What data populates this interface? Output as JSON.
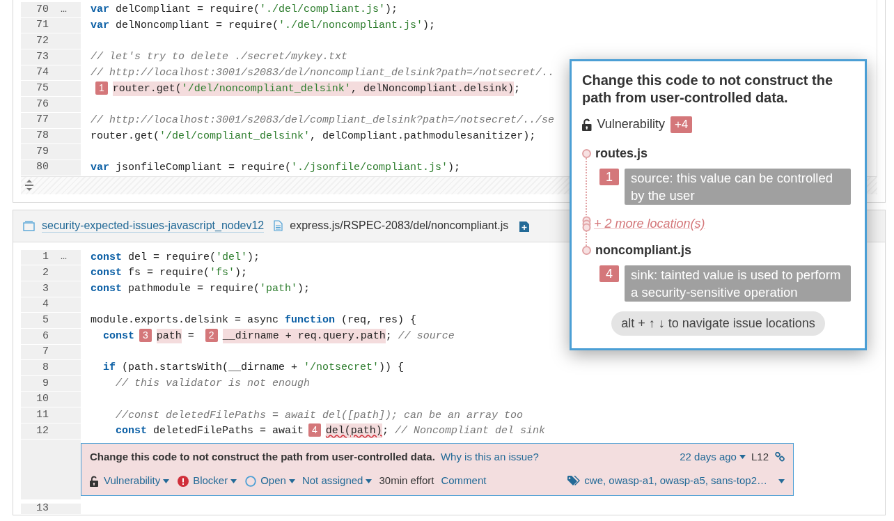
{
  "top_panel": {
    "lines": [
      {
        "number": "70",
        "gutter_mark": "…",
        "segments": [
          {
            "kind": "kw",
            "t": "var"
          },
          {
            "kind": "plain",
            "t": " delCompliant = require("
          },
          {
            "kind": "str",
            "t": "'./del/compliant.js'"
          },
          {
            "kind": "plain",
            "t": ");"
          }
        ]
      },
      {
        "number": "71",
        "segments": [
          {
            "kind": "kw",
            "t": "var"
          },
          {
            "kind": "plain",
            "t": " delNoncompliant = require("
          },
          {
            "kind": "str",
            "t": "'./del/noncompliant.js'"
          },
          {
            "kind": "plain",
            "t": ");"
          }
        ]
      },
      {
        "number": "72"
      },
      {
        "number": "73",
        "segments": [
          {
            "kind": "cmt",
            "t": "// let's try to delete ./secret/mykey.txt"
          }
        ]
      },
      {
        "number": "74",
        "segments": [
          {
            "kind": "cmt",
            "t": "// http://localhost:3001/s2083/del/noncompliant_delsink?path=/notsecret/.."
          }
        ]
      },
      {
        "number": "75",
        "segments": [
          {
            "kind": "marker",
            "t": "1"
          },
          {
            "kind": "plain",
            "t": "router.get(",
            "hl": true
          },
          {
            "kind": "str",
            "t": "'/del/noncompliant_delsink'",
            "hl": true
          },
          {
            "kind": "plain",
            "t": ", delNoncompliant.delsink)",
            "hl": true
          },
          {
            "kind": "plain",
            "t": ";"
          }
        ]
      },
      {
        "number": "76"
      },
      {
        "number": "77",
        "segments": [
          {
            "kind": "cmt",
            "t": "// http://localhost:3001/s2083/del/compliant_delsink?path=/notsecret/../se"
          }
        ]
      },
      {
        "number": "78",
        "segments": [
          {
            "kind": "plain",
            "t": "router.get("
          },
          {
            "kind": "str",
            "t": "'/del/compliant_delsink'"
          },
          {
            "kind": "plain",
            "t": ", delCompliant.pathmodulesanitizer);"
          }
        ]
      },
      {
        "number": "79"
      },
      {
        "number": "80",
        "segments": [
          {
            "kind": "kw",
            "t": "var"
          },
          {
            "kind": "plain",
            "t": " jsonfileCompliant = require("
          },
          {
            "kind": "str",
            "t": "'./jsonfile/compliant.js'"
          },
          {
            "kind": "plain",
            "t": ");"
          }
        ]
      }
    ]
  },
  "file_header": {
    "project": "security-expected-issues-javascript_nodev12",
    "path": "express.js/RSPEC-2083/del/noncompliant.js"
  },
  "bottom_panel": {
    "lines": [
      {
        "number": "1",
        "gutter_mark": "…",
        "segments": [
          {
            "kind": "kw",
            "t": "const"
          },
          {
            "kind": "plain",
            "t": " del = require("
          },
          {
            "kind": "str",
            "t": "'del'"
          },
          {
            "kind": "plain",
            "t": ");"
          }
        ]
      },
      {
        "number": "2",
        "segments": [
          {
            "kind": "kw",
            "t": "const"
          },
          {
            "kind": "plain",
            "t": " fs = require("
          },
          {
            "kind": "str",
            "t": "'fs'"
          },
          {
            "kind": "plain",
            "t": ");"
          }
        ]
      },
      {
        "number": "3",
        "segments": [
          {
            "kind": "kw",
            "t": "const"
          },
          {
            "kind": "plain",
            "t": " pathmodule = require("
          },
          {
            "kind": "str",
            "t": "'path'"
          },
          {
            "kind": "plain",
            "t": ");"
          }
        ]
      },
      {
        "number": "4"
      },
      {
        "number": "5",
        "segments": [
          {
            "kind": "plain",
            "t": "module.exports.delsink = async "
          },
          {
            "kind": "kw",
            "t": "function"
          },
          {
            "kind": "plain",
            "t": " (req, res) {"
          }
        ]
      },
      {
        "number": "6",
        "segments": [
          {
            "kind": "kw",
            "t": "  const"
          },
          {
            "kind": "marker",
            "t": "3"
          },
          {
            "kind": "plain",
            "t": "path",
            "hl": true
          },
          {
            "kind": "plain",
            "t": " = "
          },
          {
            "kind": "marker",
            "t": "2"
          },
          {
            "kind": "plain",
            "t": "__dirname + req.query.path",
            "hl": true
          },
          {
            "kind": "plain",
            "t": ";"
          },
          {
            "kind": "cmt",
            "t": " // source"
          }
        ]
      },
      {
        "number": "7"
      },
      {
        "number": "8",
        "segments": [
          {
            "kind": "kw",
            "t": "  if"
          },
          {
            "kind": "plain",
            "t": " (path.startsWith(__dirname + "
          },
          {
            "kind": "str",
            "t": "'/notsecret'"
          },
          {
            "kind": "plain",
            "t": ")) {"
          }
        ]
      },
      {
        "number": "9",
        "segments": [
          {
            "kind": "cmt",
            "t": "    // this validator is not enough"
          }
        ]
      },
      {
        "number": "10"
      },
      {
        "number": "11",
        "segments": [
          {
            "kind": "cmt",
            "t": "    //const deletedFilePaths = await del([path]); can be an array too"
          }
        ]
      },
      {
        "number": "12",
        "segments": [
          {
            "kind": "kw",
            "t": "    const"
          },
          {
            "kind": "plain",
            "t": " deletedFilePaths = await"
          },
          {
            "kind": "marker",
            "t": "4"
          },
          {
            "kind": "plain",
            "t": "del(path)",
            "hl": true,
            "squiggle": true
          },
          {
            "kind": "plain",
            "t": ";"
          },
          {
            "kind": "cmt",
            "t": " // Noncompliant del sink"
          }
        ]
      }
    ],
    "issue": {
      "message": "Change this code to not construct the path from user-controlled data.",
      "why_link": "Why is this an issue?",
      "age": "22 days ago",
      "line": "L12",
      "type": "Vulnerability",
      "severity": "Blocker",
      "status": "Open",
      "assignee": "Not assigned",
      "effort": "30min effort",
      "comment": "Comment",
      "tags": "cwe, owasp-a1, owasp-a5, sans-top2…"
    },
    "trailing_lines": [
      {
        "number": "13"
      }
    ]
  },
  "popup": {
    "title": "Change this code to not construct the path from user-controlled data.",
    "type": "Vulnerability",
    "count": "+4",
    "hint": "alt + ↑ ↓ to navigate issue locations",
    "locations": [
      {
        "kind": "file",
        "name": "routes.js"
      },
      {
        "kind": "step",
        "number": "1",
        "text": "source: this value can be controlled by the user"
      },
      {
        "kind": "more",
        "text": "+ 2 more location(s)"
      },
      {
        "kind": "file",
        "name": "noncompliant.js"
      },
      {
        "kind": "step",
        "number": "4",
        "text": "sink: tainted value is used to perform a security-sensitive operation"
      }
    ]
  }
}
